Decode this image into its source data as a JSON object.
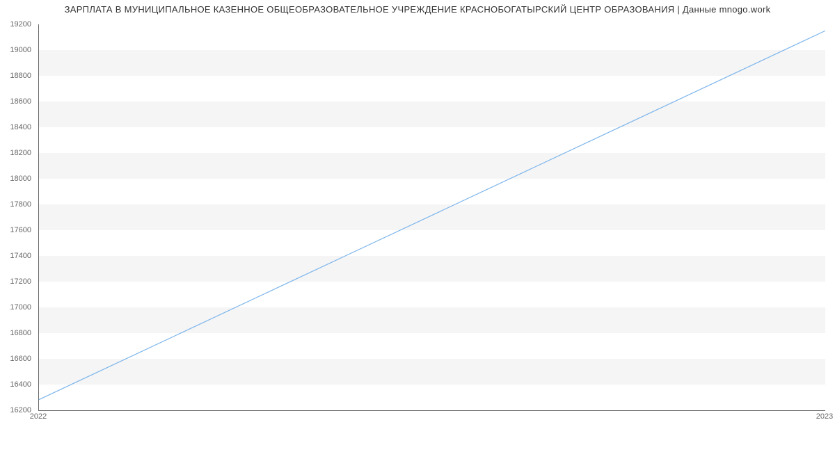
{
  "chart_data": {
    "type": "line",
    "title": "ЗАРПЛАТА В МУНИЦИПАЛЬНОЕ КАЗЕННОЕ ОБЩЕОБРАЗОВАТЕЛЬНОЕ УЧРЕЖДЕНИЕ КРАСНОБОГАТЫРСКИЙ ЦЕНТР ОБРАЗОВАНИЯ | Данные mnogo.work",
    "x": [
      "2022",
      "2023"
    ],
    "values": [
      16283,
      19150
    ],
    "ylim": [
      16200,
      19200
    ],
    "yticks": [
      16200,
      16400,
      16600,
      16800,
      17000,
      17200,
      17400,
      17600,
      17800,
      18000,
      18200,
      18400,
      18600,
      18800,
      19000,
      19200
    ],
    "xlabel": "",
    "ylabel": "",
    "grid": true,
    "colors": {
      "line": "#7cb5ec",
      "band": "#f5f5f5"
    }
  }
}
